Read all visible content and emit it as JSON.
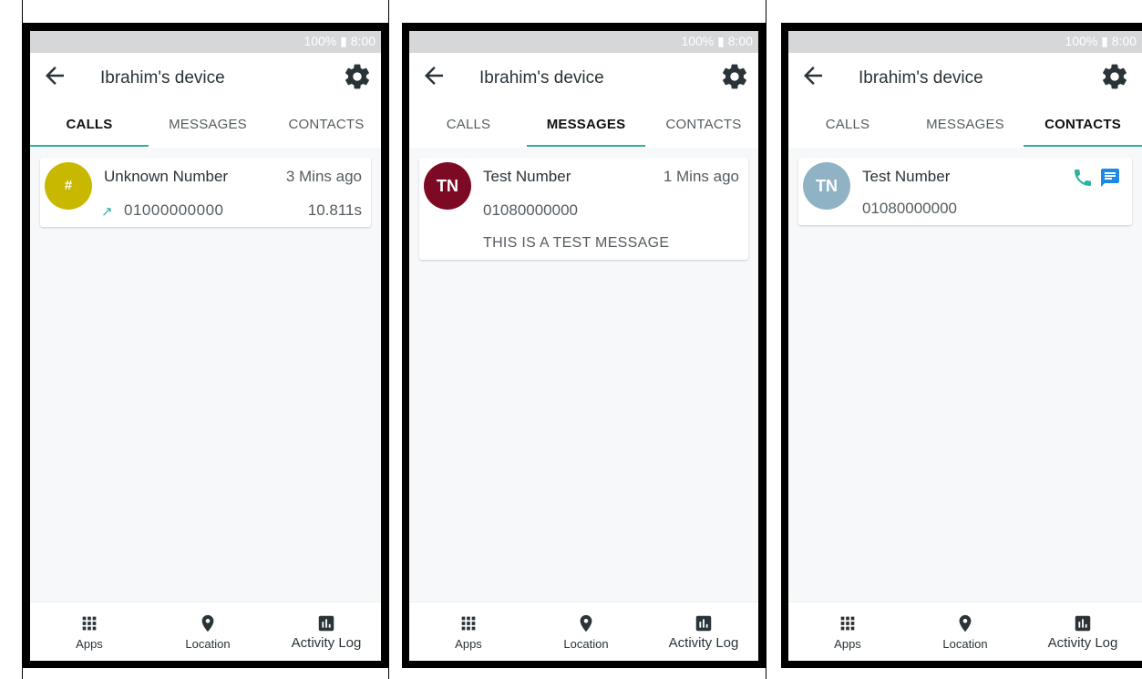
{
  "status": {
    "text": "100% ▮ 8:00"
  },
  "device_title": "Ibrahim's device",
  "tabs": [
    "CALLS",
    "MESSAGES",
    "CONTACTS"
  ],
  "bottom_nav": [
    "Apps",
    "Location",
    "Activity Log"
  ],
  "colors": {
    "accent": "#2bb39a",
    "message_icon": "#1e88e5",
    "avatar_unknown": "#c9b800",
    "avatar_message": "#7d0a25",
    "avatar_contact": "#8fb3c5"
  },
  "calls": {
    "avatar": "#",
    "name": "Unknown Number",
    "time": "3 Mins ago",
    "direction_icon": "outgoing-arrow",
    "number": "01000000000",
    "duration": "10.811s"
  },
  "messages": {
    "avatar": "TN",
    "name": "Test Number",
    "time": "1 Mins ago",
    "number": "01080000000",
    "body": "THIS IS A TEST MESSAGE"
  },
  "contacts": {
    "avatar": "TN",
    "name": "Test Number",
    "number": "01080000000",
    "icons": [
      "phone-icon",
      "message-icon"
    ]
  }
}
